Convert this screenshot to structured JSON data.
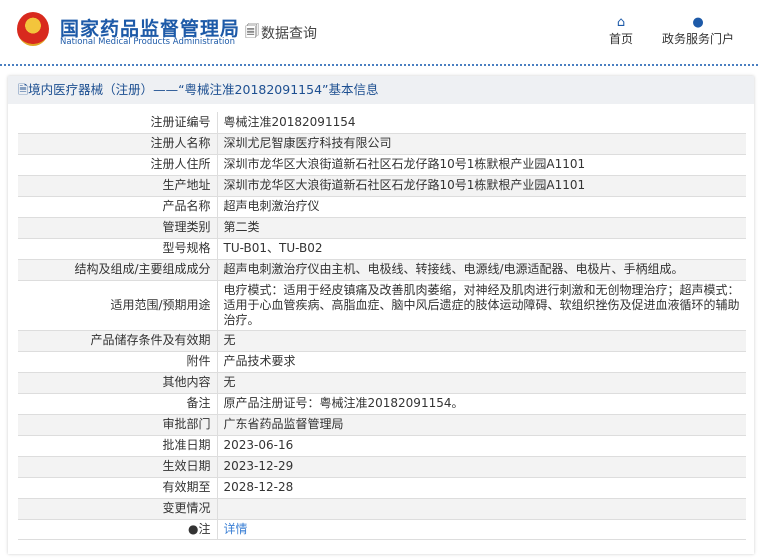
{
  "header": {
    "brand_cn": "国家药品监督管理局",
    "brand_en": "National Medical Products Administration",
    "query_label": "数据查询",
    "nav": [
      {
        "label": "首页",
        "icon": "home-icon"
      },
      {
        "label": "政务服务门户",
        "icon": "user-icon"
      }
    ]
  },
  "panel": {
    "title": "境内医疗器械（注册）——“粤械注准20182091154”基本信息"
  },
  "rows": [
    {
      "label": "注册证编号",
      "value": "粤械注准20182091154"
    },
    {
      "label": "注册人名称",
      "value": "深圳尤尼智康医疗科技有限公司"
    },
    {
      "label": "注册人住所",
      "value": "深圳市龙华区大浪街道新石社区石龙仔路10号1栋默根产业园A1101"
    },
    {
      "label": "生产地址",
      "value": "深圳市龙华区大浪街道新石社区石龙仔路10号1栋默根产业园A1101"
    },
    {
      "label": "产品名称",
      "value": "超声电刺激治疗仪"
    },
    {
      "label": "管理类别",
      "value": "第二类"
    },
    {
      "label": "型号规格",
      "value": "TU-B01、TU-B02"
    },
    {
      "label": "结构及组成/主要组成成分",
      "value": "超声电刺激治疗仪由主机、电极线、转接线、电源线/电源适配器、电极片、手柄组成。"
    },
    {
      "label": "适用范围/预期用途",
      "value": "电疗模式：适用于经皮镇痛及改善肌肉萎缩，对神经及肌肉进行刺激和无创物理治疗；超声模式：适用于心血管疾病、高脂血症、脑中风后遗症的肢体运动障碍、软组织挫伤及促进血液循环的辅助治疗。"
    },
    {
      "label": "产品储存条件及有效期",
      "value": "无"
    },
    {
      "label": "附件",
      "value": "产品技术要求"
    },
    {
      "label": "其他内容",
      "value": "无"
    },
    {
      "label": "备注",
      "value": "原产品注册证号：粤械注准20182091154。"
    },
    {
      "label": "审批部门",
      "value": "广东省药品监督管理局"
    },
    {
      "label": "批准日期",
      "value": "2023-06-16"
    },
    {
      "label": "生效日期",
      "value": "2023-12-29"
    },
    {
      "label": "有效期至",
      "value": "2028-12-28"
    },
    {
      "label": "变更情况",
      "value": ""
    }
  ],
  "note": {
    "label": "注",
    "link": "详情"
  }
}
